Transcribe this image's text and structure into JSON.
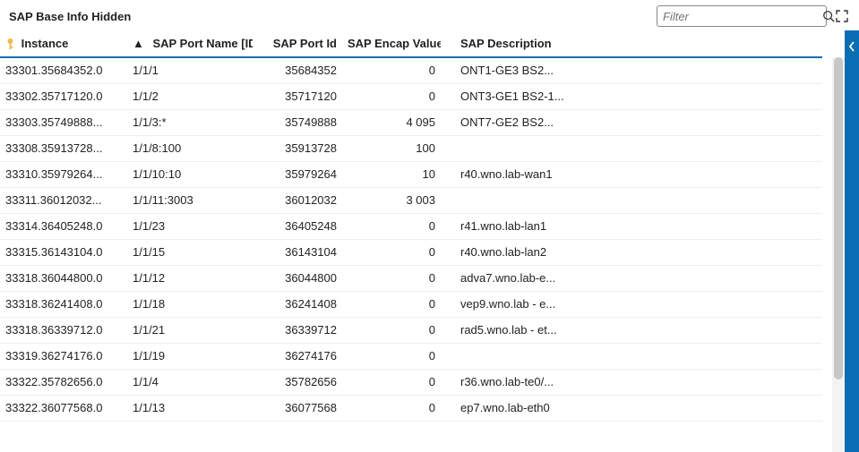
{
  "header": {
    "title": "SAP Base Info Hidden",
    "filter_placeholder": "Filter"
  },
  "table": {
    "columns": {
      "instance": "Instance",
      "port_name": "SAP Port Name [IDX]",
      "port_id": "SAP Port Id",
      "encap": "SAP Encap Value",
      "desc": "SAP Description"
    },
    "rows": [
      {
        "instance": "33301.35684352.0",
        "port_name": "1/1/1",
        "port_id": "35684352",
        "encap": "0",
        "desc": "ONT1-GE3 BS2..."
      },
      {
        "instance": "33302.35717120.0",
        "port_name": "1/1/2",
        "port_id": "35717120",
        "encap": "0",
        "desc": "ONT3-GE1 BS2-1..."
      },
      {
        "instance": "33303.35749888...",
        "port_name": "1/1/3:*",
        "port_id": "35749888",
        "encap": "4 095",
        "desc": "ONT7-GE2 BS2..."
      },
      {
        "instance": "33308.35913728...",
        "port_name": "1/1/8:100",
        "port_id": "35913728",
        "encap": "100",
        "desc": ""
      },
      {
        "instance": "33310.35979264...",
        "port_name": "1/1/10:10",
        "port_id": "35979264",
        "encap": "10",
        "desc": "r40.wno.lab-wan1"
      },
      {
        "instance": "33311.36012032...",
        "port_name": "1/1/11:3003",
        "port_id": "36012032",
        "encap": "3 003",
        "desc": ""
      },
      {
        "instance": "33314.36405248.0",
        "port_name": "1/1/23",
        "port_id": "36405248",
        "encap": "0",
        "desc": "r41.wno.lab-lan1"
      },
      {
        "instance": "33315.36143104.0",
        "port_name": "1/1/15",
        "port_id": "36143104",
        "encap": "0",
        "desc": "r40.wno.lab-lan2"
      },
      {
        "instance": "33318.36044800.0",
        "port_name": "1/1/12",
        "port_id": "36044800",
        "encap": "0",
        "desc": "adva7.wno.lab-e..."
      },
      {
        "instance": "33318.36241408.0",
        "port_name": "1/1/18",
        "port_id": "36241408",
        "encap": "0",
        "desc": "vep9.wno.lab - e..."
      },
      {
        "instance": "33318.36339712.0",
        "port_name": "1/1/21",
        "port_id": "36339712",
        "encap": "0",
        "desc": "rad5.wno.lab - et..."
      },
      {
        "instance": "33319.36274176.0",
        "port_name": "1/1/19",
        "port_id": "36274176",
        "encap": "0",
        "desc": ""
      },
      {
        "instance": "33322.35782656.0",
        "port_name": "1/1/4",
        "port_id": "35782656",
        "encap": "0",
        "desc": "r36.wno.lab-te0/..."
      },
      {
        "instance": "33322.36077568.0",
        "port_name": "1/1/13",
        "port_id": "36077568",
        "encap": "0",
        "desc": "ep7.wno.lab-eth0"
      }
    ]
  }
}
